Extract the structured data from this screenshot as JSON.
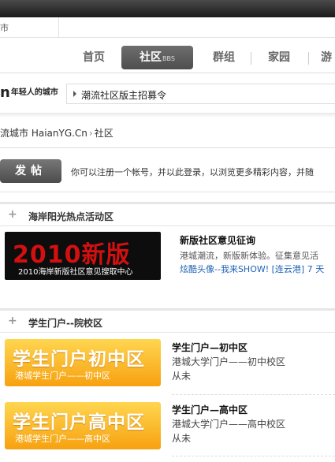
{
  "topbar": {
    "city_label": "市"
  },
  "logo": {
    "tail_letter": "n",
    "slogan": "年轻人的城市"
  },
  "nav": {
    "items": [
      {
        "label": "首页"
      },
      {
        "label": "社区",
        "sub": "BBS",
        "active": true
      },
      {
        "label": "群组"
      },
      {
        "label": "家园"
      },
      {
        "label": "游"
      }
    ]
  },
  "notice": {
    "text": "潮流社区版主招募令"
  },
  "breadcrumb": {
    "site": "流城市 HaianYG.Cn",
    "sep": "›",
    "current": "社区"
  },
  "post": {
    "button_label": "发帖",
    "tip": "你可以注册一个帐号，并以此登录，以浏览更多精彩内容，并随"
  },
  "sections": [
    {
      "title": "海岸阳光热点活动区",
      "banner": {
        "big": "2010新版",
        "small": "2010海岸新版社区意见搜取中心"
      },
      "feature": {
        "title": "新版社区意见征询",
        "desc": "港城潮流，新版新体验。征集意见活",
        "links": "炫酷头像--我来SHOW!  [连云港] 7 天"
      }
    },
    {
      "title": "学生门户--院校区",
      "forums": [
        {
          "banner_big": "学生门户初中区",
          "banner_small": "港城学生门户——初中区",
          "name": "学生门户—初中区",
          "desc": "港城大学门户——初中校区",
          "last": "从未"
        },
        {
          "banner_big": "学生门户高中区",
          "banner_small": "港城学生门户——高中区",
          "name": "学生门户—高中区",
          "desc": "港城大学门户——高中校区",
          "last": "从未"
        }
      ]
    }
  ],
  "colors": {
    "active_tab": "#5e5e5e",
    "banner_red": "#d21010",
    "school_orange": "#f7a110",
    "link_blue": "#1d62b4"
  }
}
